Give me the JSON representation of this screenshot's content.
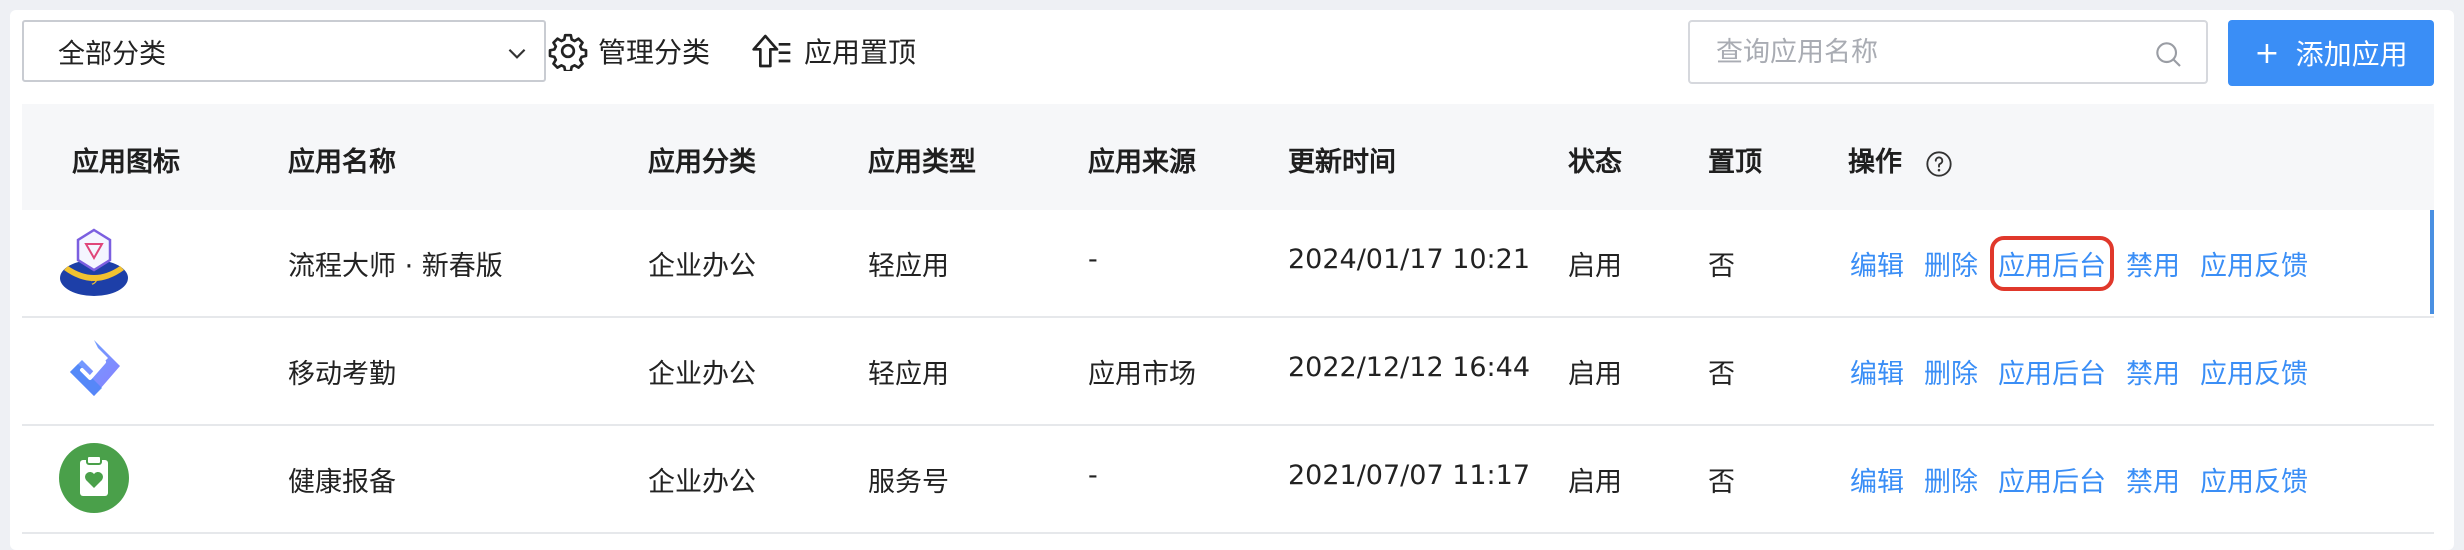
{
  "toolbar": {
    "category_select": "全部分类",
    "manage_label": "管理分类",
    "pin_label": "应用置顶",
    "search_placeholder": "查询应用名称",
    "add_label": "添加应用",
    "add_plus": "+"
  },
  "table": {
    "headers": {
      "icon": "应用图标",
      "name": "应用名称",
      "category": "应用分类",
      "type": "应用类型",
      "source": "应用来源",
      "updated": "更新时间",
      "status": "状态",
      "pinned": "置顶",
      "ops": "操作"
    },
    "ops_labels": {
      "edit": "编辑",
      "delete": "删除",
      "backend": "应用后台",
      "disable": "禁用",
      "feedback": "应用反馈"
    },
    "rows": [
      {
        "icon": "flow-master-icon",
        "name": "流程大师 · 新春版",
        "category": "企业办公",
        "type": "轻应用",
        "source": "-",
        "updated": "2024/01/17 10:21",
        "status": "启用",
        "pinned": "否"
      },
      {
        "icon": "attendance-icon",
        "name": "移动考勤",
        "category": "企业办公",
        "type": "轻应用",
        "source": "应用市场",
        "updated": "2022/12/12 16:44",
        "status": "启用",
        "pinned": "否"
      },
      {
        "icon": "health-report-icon",
        "name": "健康报备",
        "category": "企业办公",
        "type": "服务号",
        "source": "-",
        "updated": "2021/07/07 11:17",
        "status": "启用",
        "pinned": "否"
      }
    ]
  },
  "colors": {
    "accent": "#3a8ef6",
    "highlight": "#e0382b",
    "header_bg": "#f6f7f9"
  }
}
